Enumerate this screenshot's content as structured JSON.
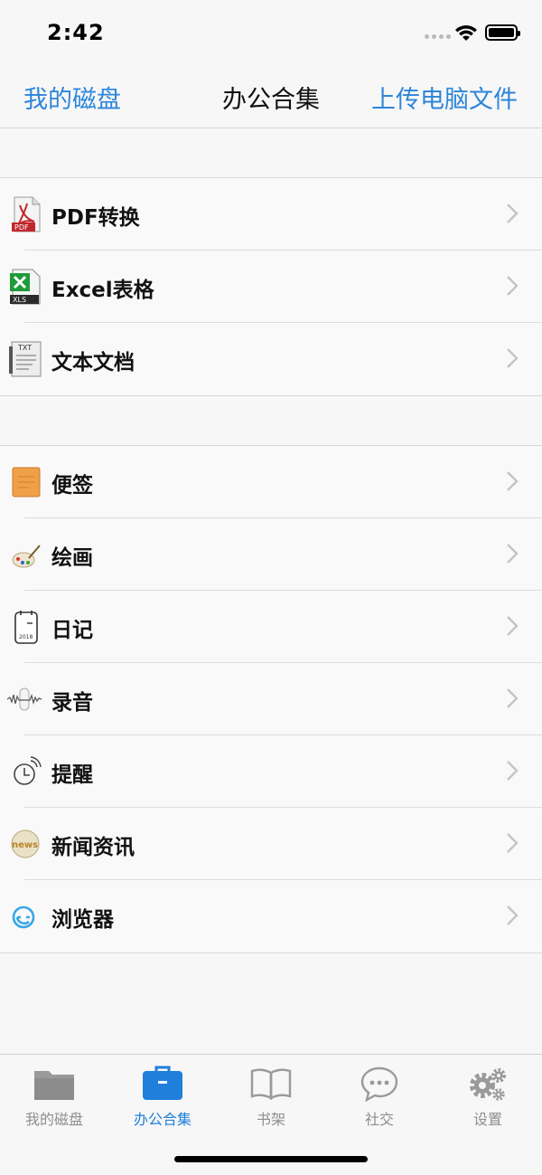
{
  "status": {
    "time": "2:42"
  },
  "nav": {
    "left": "我的磁盘",
    "title": "办公合集",
    "right": "上传电脑文件"
  },
  "group1": [
    {
      "label": "PDF转换",
      "icon": "pdf-icon"
    },
    {
      "label": "Excel表格",
      "icon": "excel-icon"
    },
    {
      "label": "文本文档",
      "icon": "txt-icon"
    }
  ],
  "group2": [
    {
      "label": "便签",
      "icon": "note-icon"
    },
    {
      "label": "绘画",
      "icon": "palette-icon"
    },
    {
      "label": "日记",
      "icon": "diary-icon"
    },
    {
      "label": "录音",
      "icon": "recording-icon"
    },
    {
      "label": "提醒",
      "icon": "reminder-icon"
    },
    {
      "label": "新闻资讯",
      "icon": "news-icon"
    },
    {
      "label": "浏览器",
      "icon": "browser-icon"
    }
  ],
  "icon_text": {
    "pdf": "PDF",
    "xls": "XLS",
    "txt": "TXT",
    "year": "2018",
    "news": "news"
  },
  "tabs": [
    {
      "label": "我的磁盘",
      "icon": "folder-icon"
    },
    {
      "label": "办公合集",
      "icon": "briefcase-icon",
      "active": true
    },
    {
      "label": "书架",
      "icon": "book-icon"
    },
    {
      "label": "社交",
      "icon": "chat-icon"
    },
    {
      "label": "设置",
      "icon": "gear-icon"
    }
  ],
  "colors": {
    "accent": "#2d86d9",
    "tab_active": "#1f7fdb",
    "tab_inactive": "#8e8e8e"
  }
}
